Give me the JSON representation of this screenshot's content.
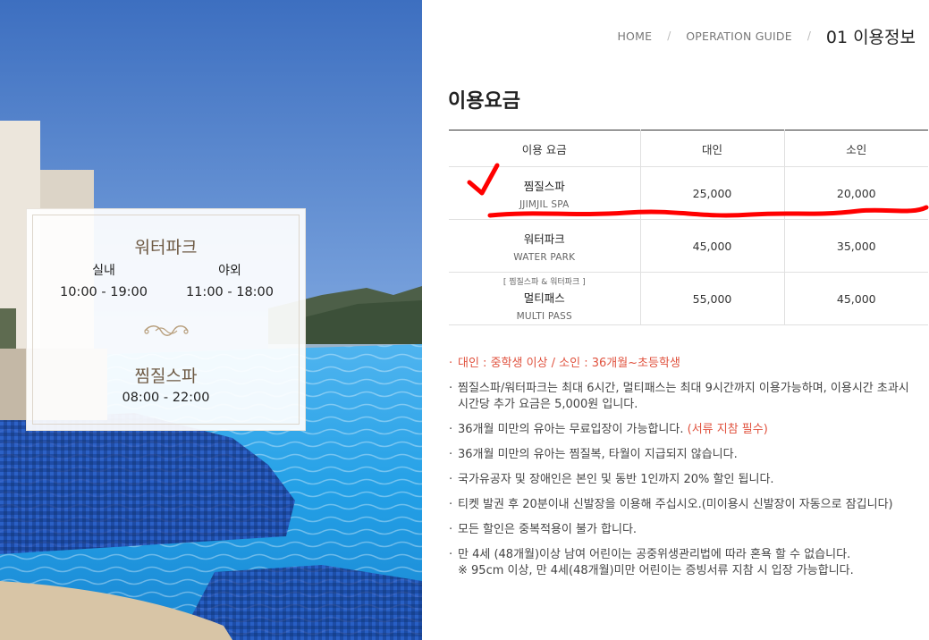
{
  "breadcrumb": {
    "home": "HOME",
    "separator": "/",
    "guide": "OPERATION GUIDE",
    "current": "01 이용정보"
  },
  "hours_card": {
    "waterpark_title": "워터파크",
    "indoor_label": "실내",
    "indoor_hours": "10:00 - 19:00",
    "outdoor_label": "야외",
    "outdoor_hours": "11:00 - 18:00",
    "spa_title": "찜질스파",
    "spa_hours": "08:00 - 22:00"
  },
  "section_title": "이용요금",
  "table": {
    "headers": [
      "이용 요금",
      "대인",
      "소인"
    ],
    "rows": [
      {
        "name": "찜질스파",
        "name_en": "JJIMJIL SPA",
        "adult": "25,000",
        "child": "20,000"
      },
      {
        "name": "워터파크",
        "name_en": "WATER PARK",
        "adult": "45,000",
        "child": "35,000"
      },
      {
        "note": "[ 찜질스파 & 워터파크 ]",
        "name": "멀티패스",
        "name_en": "MULTI PASS",
        "adult": "55,000",
        "child": "45,000"
      }
    ]
  },
  "notes": {
    "n1": "대인 : 중학생 이상 / 소인 : 36개월~초등학생",
    "n2_a": "찜질스파/워터파크는 최대 6시간, 멀티패스는 최대 9시간까지 이용가능하며, 이용시간 초과시",
    "n2_b": "시간당 추가 요금은 5,000원 입니다.",
    "n3_text": "36개월 미만의 유아는 무료입장이 가능합니다.",
    "n3_red": "(서류 지참 필수)",
    "n4": "36개월 미만의 유아는 찜질복, 타월이 지급되지 않습니다.",
    "n5": "국가유공자 및 장애인은 본인 및 동반 1인까지 20% 할인 됩니다.",
    "n6": "티켓 발권 후 20분이내 신발장을 이용해 주십시오.(미이용시 신발장이 자동으로 잠깁니다)",
    "n7": "모든 할인은 중복적용이 불가 합니다.",
    "n8_a": "만 4세 (48개월)이상 남여 어린이는 공중위생관리법에 따라 혼욕 할 수 없습니다.",
    "n8_b": "※ 95cm 이상, 만 4세(48개월)미만 어린이는 증빙서류 지참 시 입장 가능합니다."
  },
  "colors": {
    "accent_red": "#e0533f",
    "markup_red": "#ff0000",
    "card_title": "#6e5a44"
  },
  "icons": {
    "ornament": "scroll-ornament-icon",
    "annotation": "checkmark-icon"
  }
}
